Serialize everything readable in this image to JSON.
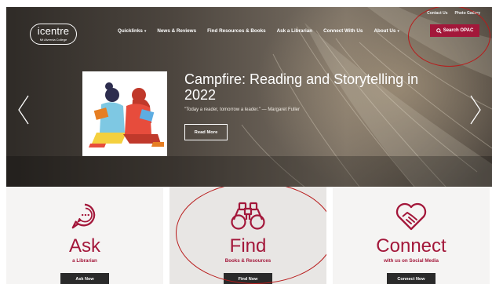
{
  "utility_links": [
    "Contact Us",
    "Photo Gallery"
  ],
  "logo": {
    "name": "icentre",
    "subtitle": "Mt Alvernia College"
  },
  "nav": {
    "items": [
      {
        "label": "Quicklinks",
        "caret": "▾"
      },
      {
        "label": "News & Reviews",
        "caret": ""
      },
      {
        "label": "Find Resources & Books",
        "caret": ""
      },
      {
        "label": "Ask a Librarian",
        "caret": ""
      },
      {
        "label": "Connect With Us",
        "caret": ""
      },
      {
        "label": "About Us",
        "caret": "▾"
      }
    ],
    "search_button": "Search OPAC"
  },
  "hero": {
    "title": "Campfire: Reading and Storytelling in 2022",
    "quote": "\"Today a reader, tomorrow a leader.\" — Margaret Fuller",
    "button": "Read More"
  },
  "cards": [
    {
      "title": "Ask",
      "subtitle": "a Librarian",
      "button": "Ask Now",
      "icon": "chat-bubble-icon"
    },
    {
      "title": "Find",
      "subtitle": "Books & Resources",
      "button": "Find Now",
      "icon": "binoculars-icon"
    },
    {
      "title": "Connect",
      "subtitle": "with us on Social Media",
      "button": "Connect Now",
      "icon": "handshake-heart-icon"
    }
  ],
  "colors": {
    "accent": "#a3173a",
    "annotation": "#b81b1b",
    "dark_button": "#2a2a2a"
  }
}
